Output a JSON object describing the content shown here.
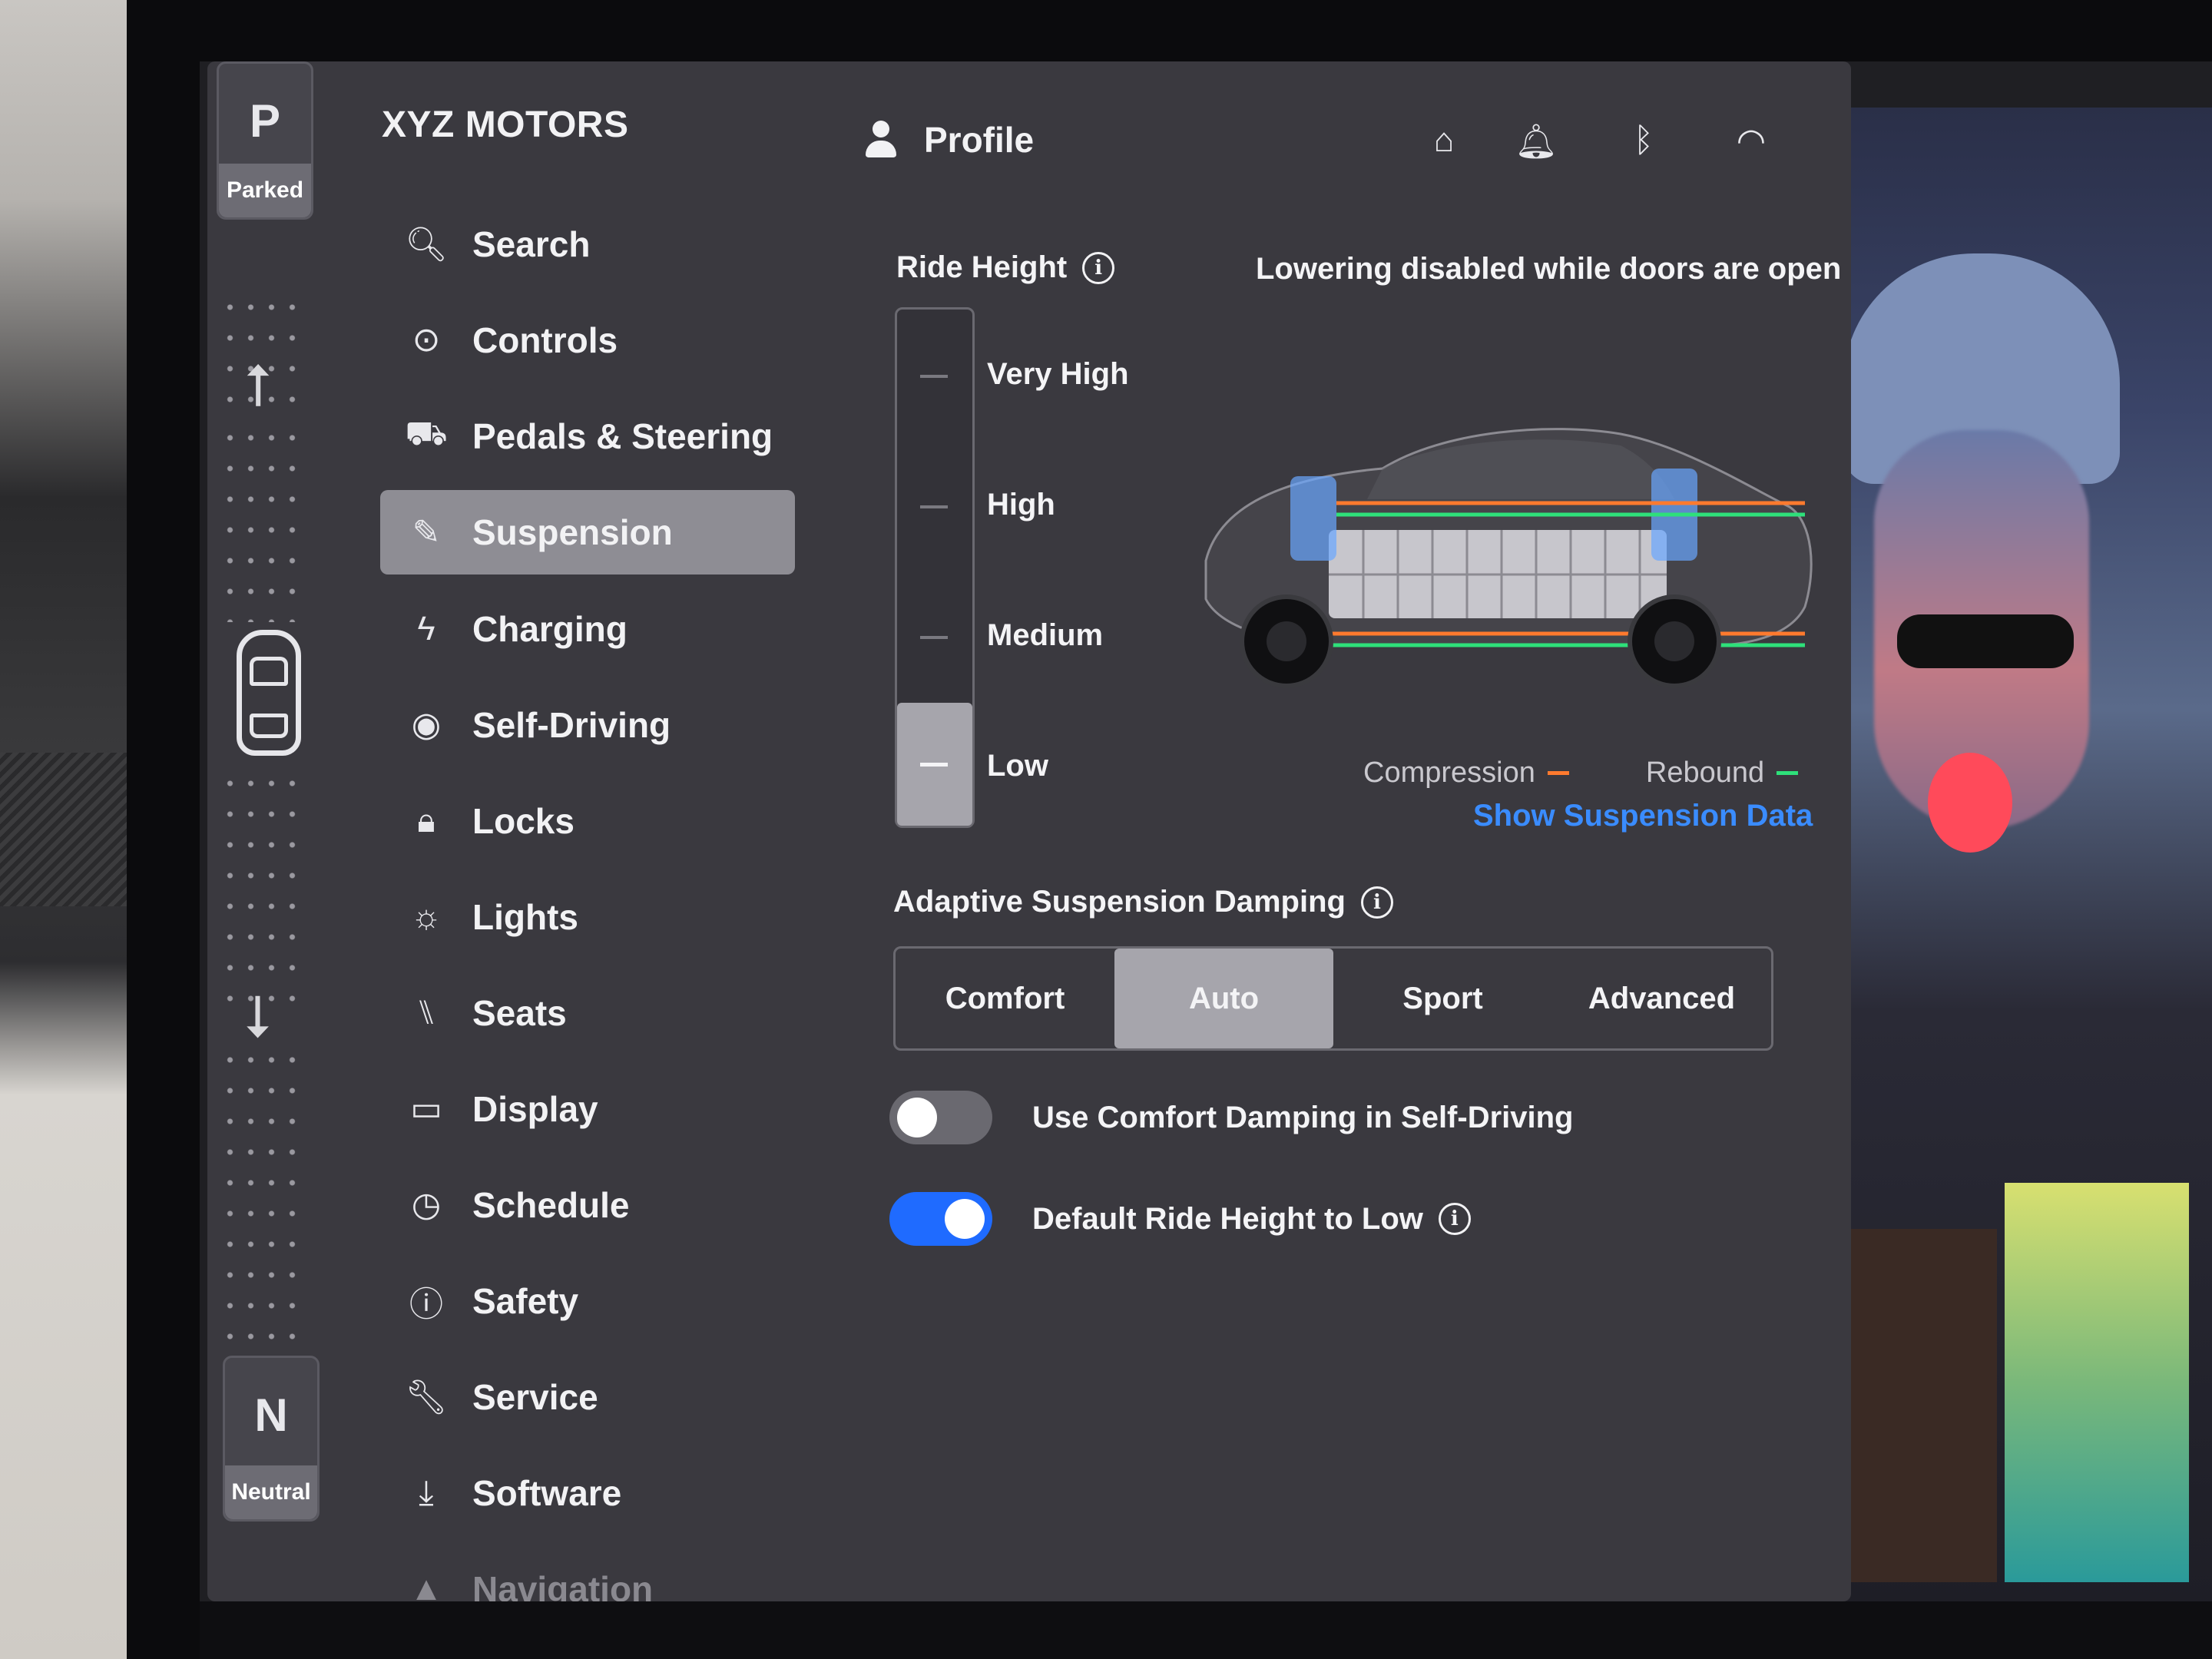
{
  "gear": {
    "top": {
      "letter": "P",
      "label": "Parked"
    },
    "bottom": {
      "letter": "N",
      "label": "Neutral"
    },
    "up_arrow": "⭡",
    "down_arrow": "⭣"
  },
  "brand": "XYZ MOTORS",
  "nav": [
    {
      "id": "search",
      "label": "Search",
      "icon": "search-icon",
      "glyph": "🔍︎"
    },
    {
      "id": "controls",
      "label": "Controls",
      "icon": "toggle-icon",
      "glyph": "⊙"
    },
    {
      "id": "pedals-steering",
      "label": "Pedals & Steering",
      "icon": "car-icon",
      "glyph": "⛟"
    },
    {
      "id": "suspension",
      "label": "Suspension",
      "icon": "suspension-icon",
      "glyph": "✎",
      "active": true
    },
    {
      "id": "charging",
      "label": "Charging",
      "icon": "lightning-icon",
      "glyph": "ϟ"
    },
    {
      "id": "self-driving",
      "label": "Self-Driving",
      "icon": "steering-wheel-icon",
      "glyph": "◉"
    },
    {
      "id": "locks",
      "label": "Locks",
      "icon": "lock-icon",
      "glyph": "🔒︎"
    },
    {
      "id": "lights",
      "label": "Lights",
      "icon": "light-icon",
      "glyph": "☼"
    },
    {
      "id": "seats",
      "label": "Seats",
      "icon": "seat-icon",
      "glyph": "⑊"
    },
    {
      "id": "display",
      "label": "Display",
      "icon": "display-icon",
      "glyph": "▭"
    },
    {
      "id": "schedule",
      "label": "Schedule",
      "icon": "clock-icon",
      "glyph": "◷"
    },
    {
      "id": "safety",
      "label": "Safety",
      "icon": "safety-icon",
      "glyph": "ⓘ"
    },
    {
      "id": "service",
      "label": "Service",
      "icon": "wrench-icon",
      "glyph": "🔧︎"
    },
    {
      "id": "software",
      "label": "Software",
      "icon": "download-icon",
      "glyph": "⤓"
    },
    {
      "id": "navigation",
      "label": "Navigation",
      "icon": "navigation-icon",
      "glyph": "▲",
      "dim": true
    }
  ],
  "header": {
    "profile_label": "Profile",
    "icons": [
      {
        "name": "garage-icon",
        "glyph": "⌂"
      },
      {
        "name": "bell-icon",
        "glyph": "🔔︎"
      },
      {
        "name": "bluetooth-icon",
        "glyph": "ᛒ"
      },
      {
        "name": "wifi-icon",
        "glyph": "◠"
      }
    ]
  },
  "ride_height": {
    "title": "Ride Height",
    "note": "Lowering disabled while doors are open",
    "levels": [
      "Very High",
      "High",
      "Medium",
      "Low"
    ],
    "selected": "Low"
  },
  "legend": {
    "compression": "Compression",
    "compression_color": "#ff7a2e",
    "rebound": "Rebound",
    "rebound_color": "#2ee07a",
    "show_data": "Show Suspension Data"
  },
  "damping": {
    "title": "Adaptive Suspension Damping",
    "options": [
      "Comfort",
      "Auto",
      "Sport",
      "Advanced"
    ],
    "selected": "Auto"
  },
  "toggles": [
    {
      "label": "Use Comfort Damping in Self-Driving",
      "on": false
    },
    {
      "label": "Default Ride Height to Low",
      "on": true,
      "info": true
    }
  ],
  "info_glyph": "i",
  "colors": {
    "accent": "#1f6bff",
    "link": "#3a8cff",
    "panel": "#3a393f"
  }
}
